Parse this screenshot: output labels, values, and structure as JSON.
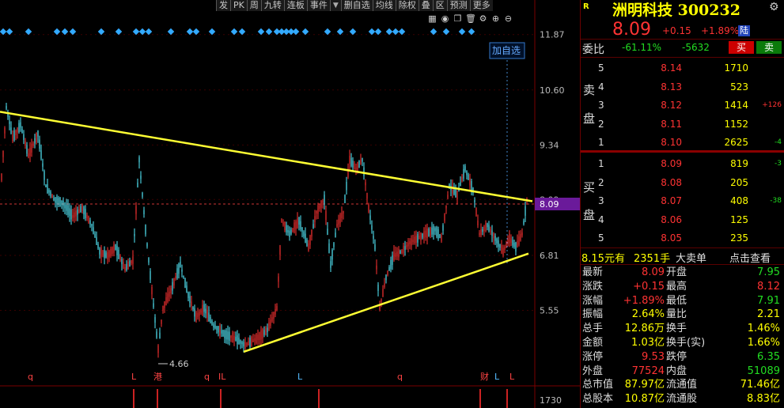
{
  "toolbar": {
    "buttons": [
      "发",
      "PK",
      "周",
      "九转",
      "连板",
      "事件",
      "▼",
      "删自选",
      "均线",
      "除权",
      "叠",
      "区",
      "预测",
      "更多"
    ],
    "add_watch": "加自选"
  },
  "chart": {
    "price_axis": [
      "11.87",
      "10.60",
      "9.34",
      "8.09",
      "6.81",
      "5.55"
    ],
    "current_price_tag": "8.09",
    "low_label": "4.66",
    "volume_axis": "1730",
    "event_markers": [
      "q",
      "L",
      "港",
      "q",
      "IL",
      "L",
      "q",
      "财",
      "L",
      "L"
    ],
    "colors": {
      "up": "#ff3333",
      "down": "#55eeff",
      "trend": "#ffff33",
      "price_line": "#cc3333",
      "current_tag": "#6a1a9a"
    }
  },
  "chart_data": {
    "type": "candlestick",
    "ylim": [
      4.0,
      12.3
    ],
    "upper_trendline": [
      [
        0,
        10.1
      ],
      [
        673,
        8.05
      ]
    ],
    "lower_trendline": [
      [
        308,
        4.6
      ],
      [
        668,
        6.85
      ]
    ],
    "points": [
      [
        2,
        8.6
      ],
      [
        8,
        10.2
      ],
      [
        16,
        9.5
      ],
      [
        26,
        9.8
      ],
      [
        36,
        9.1
      ],
      [
        48,
        9.6
      ],
      [
        58,
        8.4
      ],
      [
        68,
        8.1
      ],
      [
        80,
        8.0
      ],
      [
        92,
        7.7
      ],
      [
        104,
        7.9
      ],
      [
        116,
        7.5
      ],
      [
        126,
        6.9
      ],
      [
        136,
        6.8
      ],
      [
        146,
        7.0
      ],
      [
        158,
        6.5
      ],
      [
        168,
        6.7
      ],
      [
        176,
        9.0
      ],
      [
        184,
        7.4
      ],
      [
        192,
        6.0
      ],
      [
        200,
        4.66
      ],
      [
        206,
        5.6
      ],
      [
        216,
        6.0
      ],
      [
        228,
        6.6
      ],
      [
        238,
        5.9
      ],
      [
        248,
        5.4
      ],
      [
        258,
        5.6
      ],
      [
        270,
        5.2
      ],
      [
        284,
        5.0
      ],
      [
        298,
        4.9
      ],
      [
        310,
        4.75
      ],
      [
        324,
        4.9
      ],
      [
        338,
        5.1
      ],
      [
        350,
        5.6
      ],
      [
        356,
        7.6
      ],
      [
        366,
        7.3
      ],
      [
        378,
        7.6
      ],
      [
        390,
        7.0
      ],
      [
        400,
        7.8
      ],
      [
        410,
        8.1
      ],
      [
        418,
        6.6
      ],
      [
        426,
        7.5
      ],
      [
        434,
        7.8
      ],
      [
        442,
        9.0
      ],
      [
        450,
        8.8
      ],
      [
        458,
        9.0
      ],
      [
        466,
        7.9
      ],
      [
        474,
        7.0
      ],
      [
        480,
        5.6
      ],
      [
        488,
        6.3
      ],
      [
        498,
        6.8
      ],
      [
        508,
        6.9
      ],
      [
        518,
        7.1
      ],
      [
        528,
        7.2
      ],
      [
        538,
        7.3
      ],
      [
        550,
        7.4
      ],
      [
        558,
        7.2
      ],
      [
        568,
        8.4
      ],
      [
        578,
        8.2
      ],
      [
        588,
        8.8
      ],
      [
        598,
        8.3
      ],
      [
        606,
        7.3
      ],
      [
        616,
        7.5
      ],
      [
        626,
        7.2
      ],
      [
        636,
        6.9
      ],
      [
        644,
        7.2
      ],
      [
        652,
        7.0
      ],
      [
        660,
        7.3
      ],
      [
        666,
        8.09
      ]
    ]
  },
  "stock": {
    "marker": "R",
    "title": "洲明科技 300232",
    "price": "8.09",
    "change": "+0.15",
    "pct": "+1.89%",
    "market_badge": "陆"
  },
  "weibi": {
    "label": "委比",
    "pct": "-61.11%",
    "diff": "-5632",
    "buy_btn": "买",
    "sell_btn": "卖"
  },
  "orderbook": {
    "sell_label_1": "卖",
    "sell_label_2": "盘",
    "buy_label_1": "买",
    "buy_label_2": "盘",
    "sells": [
      {
        "lvl": "5",
        "price": "8.14",
        "vol": "1710",
        "chg": ""
      },
      {
        "lvl": "4",
        "price": "8.13",
        "vol": "523",
        "chg": ""
      },
      {
        "lvl": "3",
        "price": "8.12",
        "vol": "1414",
        "chg": "+126"
      },
      {
        "lvl": "2",
        "price": "8.11",
        "vol": "1152",
        "chg": ""
      },
      {
        "lvl": "1",
        "price": "8.10",
        "vol": "2625",
        "chg": "-4"
      }
    ],
    "buys": [
      {
        "lvl": "1",
        "price": "8.09",
        "vol": "819",
        "chg": "-3"
      },
      {
        "lvl": "2",
        "price": "8.08",
        "vol": "205",
        "chg": ""
      },
      {
        "lvl": "3",
        "price": "8.07",
        "vol": "408",
        "chg": "-38"
      },
      {
        "lvl": "4",
        "price": "8.06",
        "vol": "125",
        "chg": ""
      },
      {
        "lvl": "5",
        "price": "8.05",
        "vol": "235",
        "chg": ""
      }
    ]
  },
  "trade_strip": {
    "price": "8.15元有",
    "vol": "2351手",
    "text": "大卖单",
    "link": "点击查看"
  },
  "quote": [
    {
      "k1": "最新",
      "v1": "8.09",
      "c1": "red",
      "k2": "开盘",
      "v2": "7.95",
      "c2": "green"
    },
    {
      "k1": "涨跌",
      "v1": "+0.15",
      "c1": "red",
      "k2": "最高",
      "v2": "8.12",
      "c2": "red"
    },
    {
      "k1": "涨幅",
      "v1": "+1.89%",
      "c1": "red",
      "k2": "最低",
      "v2": "7.91",
      "c2": "green"
    },
    {
      "k1": "振幅",
      "v1": "2.64%",
      "c1": "yellow",
      "k2": "量比",
      "v2": "2.21",
      "c2": "yellow"
    },
    {
      "k1": "总手",
      "v1": "12.86万",
      "c1": "yellow",
      "k2": "换手",
      "v2": "1.46%",
      "c2": "yellow"
    },
    {
      "k1": "金额",
      "v1": "1.03亿",
      "c1": "yellow",
      "k2": "换手(实)",
      "v2": "1.66%",
      "c2": "yellow"
    },
    {
      "k1": "涨停",
      "v1": "9.53",
      "c1": "red",
      "k2": "跌停",
      "v2": "6.35",
      "c2": "green"
    },
    {
      "k1": "外盘",
      "v1": "77524",
      "c1": "red",
      "k2": "内盘",
      "v2": "51089",
      "c2": "green"
    },
    {
      "k1": "总市值",
      "v1": "87.97亿",
      "c1": "yellow",
      "k2": "流通值",
      "v2": "71.46亿",
      "c2": "yellow"
    },
    {
      "k1": "总股本",
      "v1": "10.87亿",
      "c1": "yellow",
      "k2": "流通股",
      "v2": "8.83亿",
      "c2": "yellow"
    }
  ]
}
